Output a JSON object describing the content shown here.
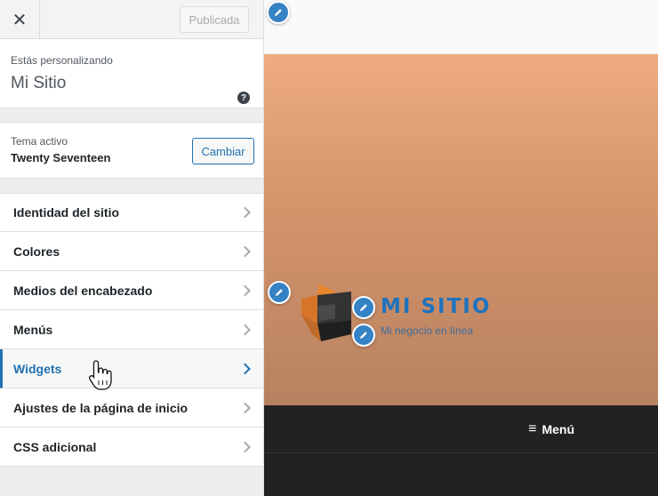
{
  "sidebar": {
    "close_glyph": "✕",
    "publish_label": "Publicada",
    "customizing_label": "Estás personalizando",
    "site_name": "Mi Sitio",
    "help_glyph": "?",
    "theme": {
      "label": "Tema activo",
      "name": "Twenty Seventeen",
      "change_label": "Cambiar"
    },
    "sections": [
      {
        "label": "Identidad del sitio"
      },
      {
        "label": "Colores"
      },
      {
        "label": "Medios del encabezado"
      },
      {
        "label": "Menús"
      },
      {
        "label": "Widgets",
        "active": true
      },
      {
        "label": "Ajustes de la página de inicio"
      },
      {
        "label": "CSS adicional"
      }
    ]
  },
  "preview": {
    "site_title": "MI SITIO",
    "site_description": "Mi negocio en línea",
    "menu_label": "Menú",
    "menu_glyph": "≡"
  },
  "colors": {
    "accent": "#2271b1",
    "pencil": "#3582c4",
    "header_top": "#eeac80",
    "header_bottom": "#b78260",
    "nav": "#222222"
  }
}
